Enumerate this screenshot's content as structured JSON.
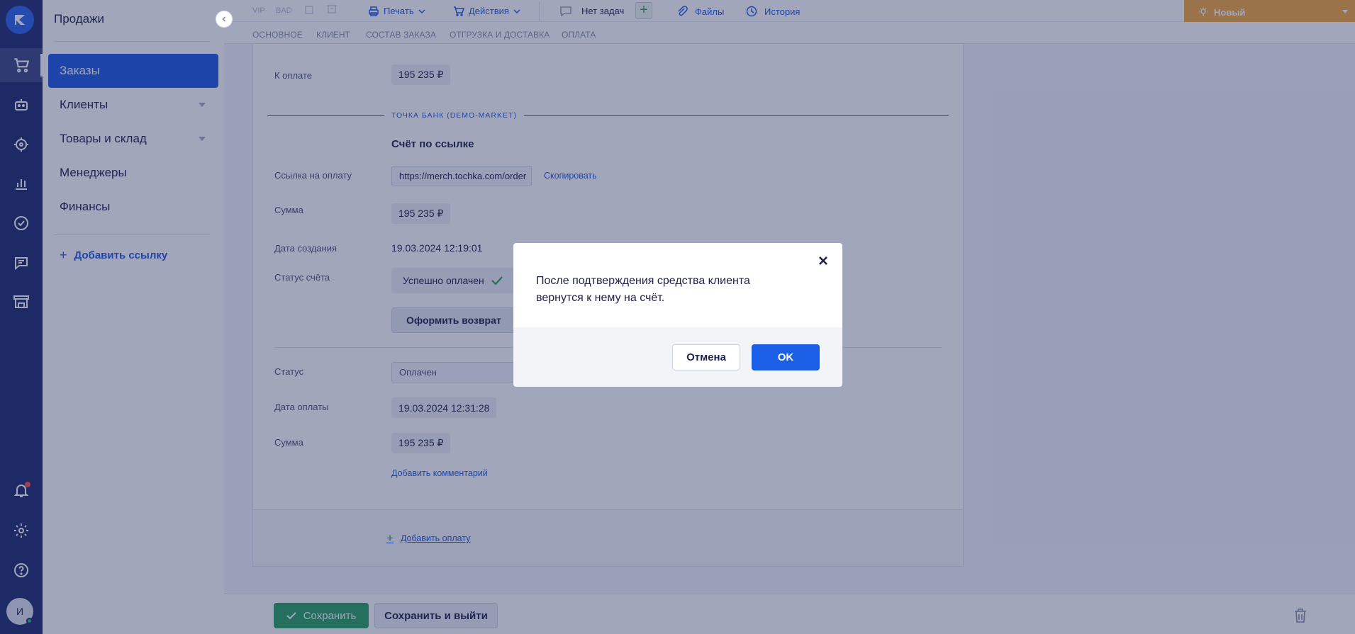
{
  "sidebar": {
    "title": "Продажи",
    "items": [
      {
        "label": "Заказы"
      },
      {
        "label": "Клиенты"
      },
      {
        "label": "Товары и склад"
      },
      {
        "label": "Менеджеры"
      },
      {
        "label": "Финансы"
      }
    ],
    "add_link": "Добавить ссылку"
  },
  "rail": {
    "avatar": "И"
  },
  "topbar": {
    "vip": "VIP",
    "bad": "BAD",
    "print": "Печать",
    "actions": "Действия",
    "tasks": "Нет задач",
    "files": "Файлы",
    "history": "История",
    "status": "Новый"
  },
  "tabs": [
    "ОСНОВНОЕ",
    "КЛИЕНТ",
    "СОСТАВ ЗАКАЗА",
    "ОТГРУЗКА И ДОСТАВКА",
    "ОПЛАТА"
  ],
  "payment": {
    "due_label": "К оплате",
    "due_value": "195 235 ₽",
    "bank_title": "ТОЧКА БАНК (DEMO-MARKET)",
    "invoice_title": "Счёт по ссылке",
    "link_label": "Ссылка на оплату",
    "link_value": "https://merch.tochka.com/order",
    "copy": "Скопировать",
    "sum_label": "Сумма",
    "sum_value": "195 235 ₽",
    "created_label": "Дата создания",
    "created_value": "19.03.2024 12:19:01",
    "invoice_status_label": "Статус счёта",
    "invoice_status_value": "Успешно оплачен",
    "refund": "Оформить возврат",
    "status_label": "Статус",
    "status_value": "Оплачен",
    "paid_date_label": "Дата оплаты",
    "paid_date_value": "19.03.2024 12:31:28",
    "sum2_label": "Сумма",
    "sum2_value": "195 235 ₽",
    "add_comment": "Добавить комментарий",
    "add_payment": "Добавить оплату"
  },
  "bottom": {
    "save": "Сохранить",
    "save_exit": "Сохранить и выйти"
  },
  "modal": {
    "message": "После подтверждения средства клиента вернутся к нему на счёт.",
    "cancel": "Отмена",
    "ok": "OK"
  },
  "colors": {
    "accent": "#1a5fe6",
    "rail": "#1e2a6b",
    "status_new": "#f3a73f",
    "save": "#2aa15f"
  }
}
